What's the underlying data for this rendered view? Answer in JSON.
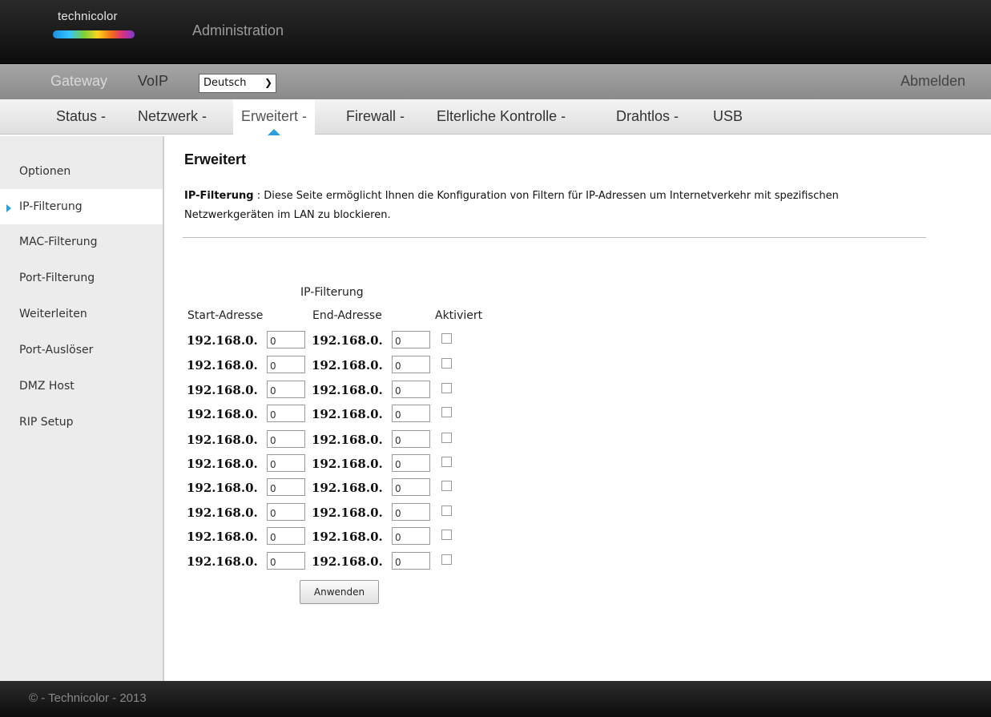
{
  "header": {
    "logo_text": "technicolor",
    "title": "Administration"
  },
  "topnav": {
    "gateway": "Gateway",
    "voip": "VoIP",
    "language": "Deutsch",
    "logout": "Abmelden"
  },
  "subnav": {
    "tabs": [
      {
        "label": "Status -"
      },
      {
        "label": "Netzwerk -"
      },
      {
        "label": "Erweitert -"
      },
      {
        "label": "Firewall -"
      },
      {
        "label": "Elterliche Kontrolle -"
      },
      {
        "label": "Drahtlos -"
      },
      {
        "label": "USB"
      }
    ],
    "active": "Erweitert -"
  },
  "sidebar": {
    "items": [
      {
        "label": "Optionen"
      },
      {
        "label": "IP-Filterung"
      },
      {
        "label": "MAC-Filterung"
      },
      {
        "label": "Port-Filterung"
      },
      {
        "label": "Weiterleiten"
      },
      {
        "label": "Port-Auslöser"
      },
      {
        "label": "DMZ Host"
      },
      {
        "label": "RIP Setup"
      }
    ],
    "active": "IP-Filterung"
  },
  "main": {
    "title": "Erweitert",
    "desc_label": "IP-Filterung",
    "desc_separator": ":",
    "desc_text": "Diese Seite ermöglicht Ihnen die Konfiguration von Filtern für IP-Adressen um Internetverkehr mit spezifischen Netzwerkgeräten im LAN zu blockieren.",
    "table_caption": "IP-Filterung",
    "col_start": "Start-Adresse",
    "col_end": "End-Adresse",
    "col_enabled": "Aktiviert",
    "ip_prefix": "192.168.0.",
    "rows": [
      {
        "start": "0",
        "end": "0",
        "enabled": false
      },
      {
        "start": "0",
        "end": "0",
        "enabled": false
      },
      {
        "start": "0",
        "end": "0",
        "enabled": false
      },
      {
        "start": "0",
        "end": "0",
        "enabled": false
      },
      {
        "start": "0",
        "end": "0",
        "enabled": false
      },
      {
        "start": "0",
        "end": "0",
        "enabled": false
      },
      {
        "start": "0",
        "end": "0",
        "enabled": false
      },
      {
        "start": "0",
        "end": "0",
        "enabled": false
      },
      {
        "start": "0",
        "end": "0",
        "enabled": false
      },
      {
        "start": "0",
        "end": "0",
        "enabled": false
      }
    ],
    "apply_label": "Anwenden"
  },
  "footer": {
    "text": "© - Technicolor - 2013"
  }
}
